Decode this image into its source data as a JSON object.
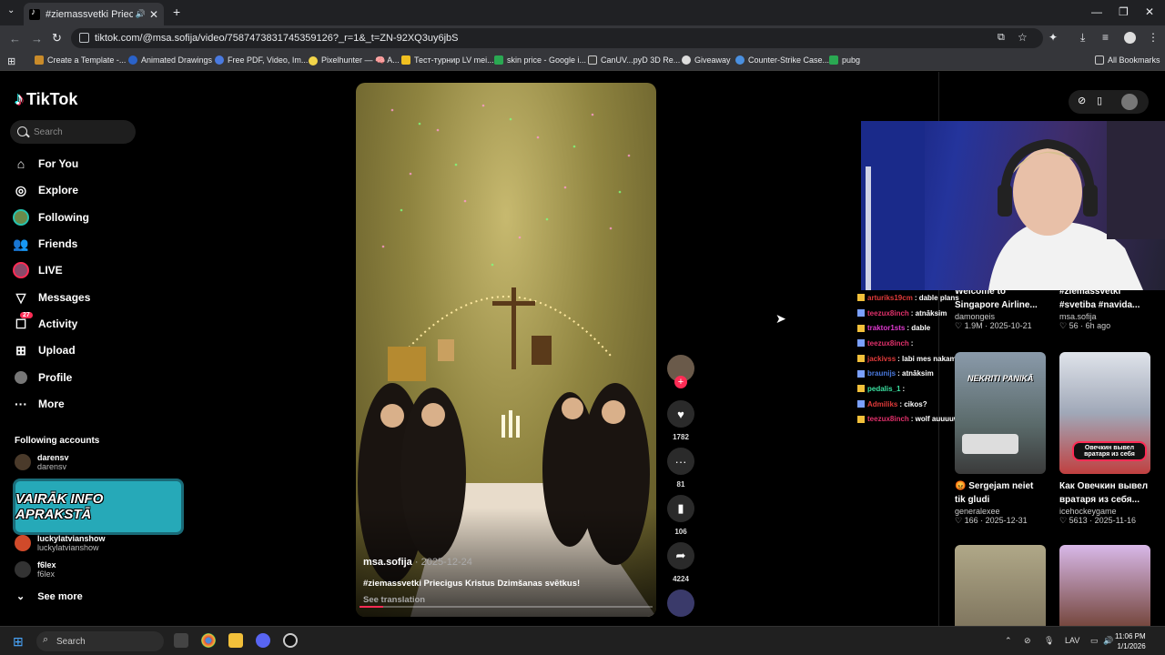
{
  "browser": {
    "tab_title": "#ziemassvetki Priecīgus Krist",
    "url": "tiktok.com/@msa.sofija/video/7587473831745359126?_r=1&_t=ZN-92XQ3uy6jbS",
    "bookmarks": [
      "Create a Template -...",
      "Animated Drawings",
      "Free PDF, Video, Im...",
      "Pixelhunter — 🧠 A...",
      "Тест-турнир LV mei...",
      "skin price - Google i...",
      "CanUV...pyD 3D Re...",
      "Giveaway",
      "Counter-Strike Case...",
      "pubg"
    ],
    "all_bookmarks": "All Bookmarks"
  },
  "tiktok": {
    "logo": "TikTok",
    "search_placeholder": "Search",
    "nav": [
      "For You",
      "Explore",
      "Following",
      "Friends",
      "LIVE",
      "Messages",
      "Activity",
      "Upload",
      "Profile",
      "More"
    ],
    "activity_badge": "27",
    "following_title": "Following accounts",
    "accounts": [
      {
        "name": "darensv",
        "sub": "darensv"
      },
      {
        "name": "luckylatvianshow",
        "sub": "luckylatvianshow"
      },
      {
        "name": "f6lex",
        "sub": "f6lex"
      }
    ],
    "promo_text": "VAIRĀK INFO APRAKSTĀ",
    "see_more": "See more"
  },
  "video": {
    "author": "msa.sofija",
    "date": " · 2025-12-24",
    "caption": "#ziemassvetki Priecigus Kristus Dzimšanas svētkus!",
    "see_translation": "See translation",
    "progress": 0.08
  },
  "actions": {
    "likes": "1782",
    "comments": "81",
    "saves": "106",
    "shares": "4224"
  },
  "chat": [
    {
      "user": "arturiks19cm",
      "msg": " : dable plans",
      "color": "#e03a3a"
    },
    {
      "user": "teezux8inch",
      "msg": " : atnāksim",
      "color": "#e0306a"
    },
    {
      "user": "traktor1sts",
      "msg": " : dable",
      "color": "#e03ad0"
    },
    {
      "user": "teezux8inch",
      "msg": " :",
      "color": "#e0306a"
    },
    {
      "user": "jackivss",
      "msg": " : labi mes nakam",
      "color": "#e03a3a"
    },
    {
      "user": "braunijs",
      "msg": " : atnāksim",
      "color": "#4a7ae0"
    },
    {
      "user": "pedalis_1",
      "msg": " :",
      "color": "#3ae0a0"
    },
    {
      "user": "Admiliks",
      "msg": " : cikos?",
      "color": "#e03a3a"
    },
    {
      "user": "teezux8inch",
      "msg": " : wolf auuuuwfff",
      "color": "#e0306a"
    }
  ],
  "cards": [
    {
      "title1": "Welcome to",
      "title2": "Singapore Airline...",
      "user": "damongeis",
      "likes": "1.9M",
      "date": "2025-10-21"
    },
    {
      "title1": "#ziemassvetki",
      "title2": "#svetiba #navida...",
      "user": "msa.sofija",
      "likes": "56",
      "date": "6h ago"
    },
    {
      "title1": "😡 Sergejam neiet",
      "title2": "tik gludi",
      "user": "generalexee",
      "likes": "166",
      "date": "2025-12-31",
      "overlay": "NEKRITI PANIKĀ"
    },
    {
      "title1": "Как Овечкин вывел",
      "title2": "вратаря из себя...",
      "user": "icehockeygame",
      "likes": "5613",
      "date": "2025-11-16",
      "overlay": "Овечкин вывел вратаря из себя"
    }
  ],
  "taskbar": {
    "search": "Search",
    "lang": "LAV",
    "time": "11:06 PM",
    "date": "1/1/2026"
  }
}
